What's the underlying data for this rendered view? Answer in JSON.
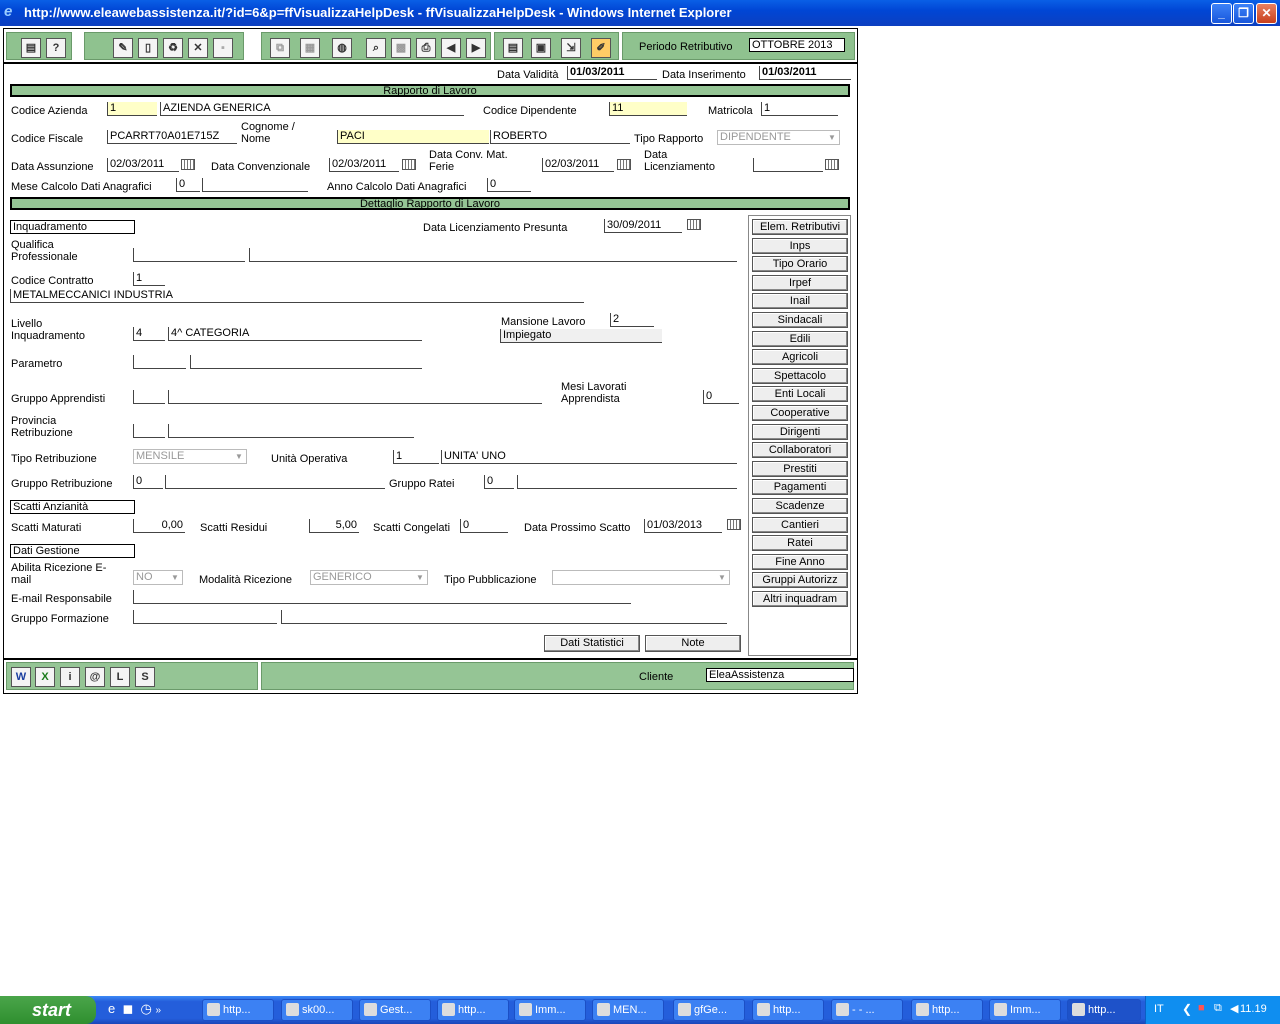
{
  "window": {
    "title": "http://www.eleawebassistenza.it/?id=6&p=ffVisualizzaHelpDesk - ffVisualizzaHelpDesk - Windows Internet Explorer"
  },
  "header": {
    "periodo_label": "Periodo Retributivo",
    "periodo_value": "OTTOBRE 2013"
  },
  "dates": {
    "validita_label": "Data Validità",
    "validita_value": "01/03/2011",
    "inserimento_label": "Data Inserimento",
    "inserimento_value": "01/03/2011"
  },
  "sections": {
    "rapporto": "Rapporto di Lavoro",
    "dettaglio": "Dettaglio Rapporto di Lavoro"
  },
  "rapporto": {
    "codice_azienda_label": "Codice Azienda",
    "codice_azienda": "1",
    "azienda_nome": "AZIENDA GENERICA",
    "codice_dipendente_label": "Codice Dipendente",
    "codice_dipendente": "11",
    "matricola_label": "Matricola",
    "matricola": "1",
    "codice_fiscale_label": "Codice Fiscale",
    "codice_fiscale": "PCARRT70A01E715Z",
    "cognome_nome_label_1": "Cognome /",
    "cognome_nome_label_2": "Nome",
    "cognome": "PACI",
    "nome": "ROBERTO",
    "tipo_rapporto_label": "Tipo Rapporto",
    "tipo_rapporto": "DIPENDENTE",
    "data_assunzione_label": "Data Assunzione",
    "data_assunzione": "02/03/2011",
    "data_convenzionale_label": "Data Convenzionale",
    "data_convenzionale": "02/03/2011",
    "data_conv_mat_label_1": "Data Conv. Mat.",
    "data_conv_mat_label_2": "Ferie",
    "data_conv_mat": "02/03/2011",
    "data_licenziamento_label_1": "Data",
    "data_licenziamento_label_2": "Licenziamento",
    "data_licenziamento": "",
    "mese_calcolo_label": "Mese Calcolo Dati Anagrafici",
    "mese_calcolo": "0",
    "anno_calcolo_label": "Anno Calcolo Dati Anagrafici",
    "anno_calcolo": "0"
  },
  "dettaglio": {
    "inquadramento_title": "Inquadramento",
    "data_lic_presunta_label": "Data Licenziamento Presunta",
    "data_lic_presunta": "30/09/2011",
    "qualifica_label_1": "Qualifica",
    "qualifica_label_2": "Professionale",
    "codice_contratto_label": "Codice Contratto",
    "codice_contratto": "1",
    "contratto_desc": "METALMECCANICI INDUSTRIA",
    "livello_label_1": "Livello",
    "livello_label_2": "Inquadramento",
    "livello": "4",
    "livello_desc": "4^ CATEGORIA",
    "mansione_label": "Mansione Lavoro",
    "mansione": "2",
    "mansione_desc": "Impiegato",
    "parametro_label": "Parametro",
    "gruppo_apprendisti_label": "Gruppo Apprendisti",
    "mesi_lavorati_label_1": "Mesi Lavorati",
    "mesi_lavorati_label_2": "Apprendista",
    "mesi_lavorati": "0",
    "provincia_label_1": "Provincia",
    "provincia_label_2": "Retribuzione",
    "tipo_retribuzione_label": "Tipo Retribuzione",
    "tipo_retribuzione": "MENSILE",
    "unita_operativa_label": "Unità Operativa",
    "unita_operativa": "1",
    "unita_operativa_desc": "UNITA' UNO",
    "gruppo_retribuzione_label": "Gruppo Retribuzione",
    "gruppo_retribuzione": "0",
    "gruppo_ratei_label": "Gruppo Ratei",
    "gruppo_ratei": "0",
    "scatti_title": "Scatti Anzianità",
    "scatti_maturati_label": "Scatti Maturati",
    "scatti_maturati": "0,00",
    "scatti_residui_label": "Scatti Residui",
    "scatti_residui": "5,00",
    "scatti_congelati_label": "Scatti Congelati",
    "scatti_congelati": "0",
    "data_prossimo_label": "Data Prossimo Scatto",
    "data_prossimo": "01/03/2013",
    "gestione_title": "Dati Gestione",
    "abilita_label_1": "Abilita Ricezione E-",
    "abilita_label_2": "mail",
    "abilita": "NO",
    "modalita_label": "Modalità Ricezione",
    "modalita": "GENERICO",
    "tipo_pubblicazione_label": "Tipo Pubblicazione",
    "tipo_pubblicazione": "",
    "email_label": "E-mail Responsabile",
    "gruppo_formazione_label": "Gruppo Formazione",
    "btn_statistici": "Dati Statistici",
    "btn_note": "Note"
  },
  "side_buttons": [
    "Elem. Retributivi",
    "Inps",
    "Tipo Orario",
    "Irpef",
    "Inail",
    "Sindacali",
    "Edili",
    "Agricoli",
    "Spettacolo",
    "Enti Locali",
    "Cooperative",
    "Dirigenti",
    "Collaboratori",
    "Prestiti",
    "Pagamenti",
    "Scadenze",
    "Cantieri",
    "Ratei",
    "Fine Anno",
    "Gruppi Autorizz",
    "Altri inquadram"
  ],
  "footer": {
    "cliente_label": "Cliente",
    "cliente_value": "EleaAssistenza"
  },
  "taskbar": {
    "start": "start",
    "items": [
      "http...",
      "sk00...",
      "Gest...",
      "http...",
      "Imm...",
      "MEN...",
      "gfGe...",
      "http...",
      "- - ...",
      "http...",
      "Imm...",
      "http..."
    ],
    "lang": "IT",
    "clock": "11.19"
  }
}
